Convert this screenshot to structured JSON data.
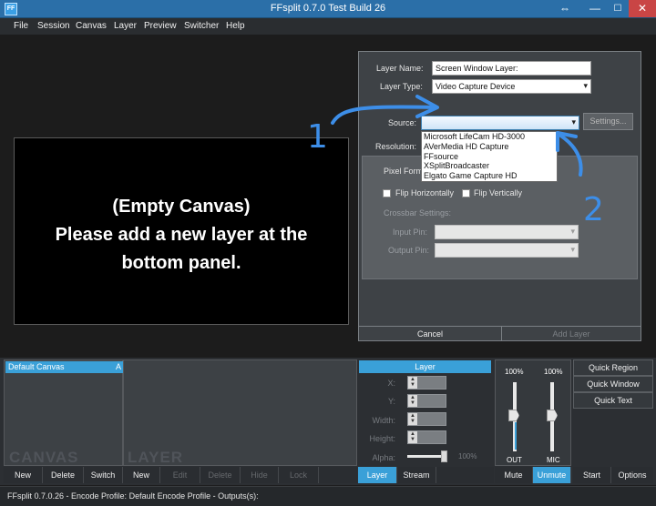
{
  "window": {
    "app_icon": "FF",
    "title": "FFsplit 0.7.0 Test Build 26",
    "resize_icon": "⇔",
    "minimize": "—",
    "maximize": "☐",
    "close": "✕"
  },
  "menu": [
    "File",
    "Session",
    "Canvas",
    "Layer",
    "Preview",
    "Switcher",
    "Help"
  ],
  "canvas_preview": {
    "line1": "(Empty Canvas)",
    "line2": "Please add a new layer at the",
    "line3": "bottom panel."
  },
  "layer_dialog": {
    "layer_name_label": "Layer Name:",
    "layer_name_value": "Screen Window Layer:",
    "layer_type_label": "Layer Type:",
    "layer_type_value": "Video Capture Device",
    "source_label": "Source:",
    "settings_label": "Settings...",
    "resolution_label": "Resolution:",
    "pixel_format_label": "Pixel Forma",
    "source_options": [
      "Microsoft LifeCam HD-3000",
      "AVerMedia HD Capture",
      "FFsource",
      "XSplitBroadcaster",
      "Elgato Game Capture HD"
    ],
    "flip_horizontally_label": "Flip Horizontally",
    "flip_vertically_label": "Flip Vertically",
    "crossbar_label": "Crossbar Settings:",
    "input_pin_label": "Input Pin:",
    "output_pin_label": "Output Pin:",
    "cancel_label": "Cancel",
    "add_layer_label": "Add Layer"
  },
  "annotations": {
    "step1": "1",
    "step2": "2",
    "color": "#3d8ee8"
  },
  "canvas_panel": {
    "item": "Default Canvas",
    "item_badge": "A",
    "watermark": "CANVAS",
    "buttons": [
      "New",
      "Delete",
      "Switch"
    ]
  },
  "layer_panel": {
    "watermark": "LAYER",
    "buttons": [
      "New",
      "Edit",
      "Delete",
      "Hide",
      "Lock"
    ]
  },
  "layer_props": {
    "title": "Layer",
    "x_label": "X:",
    "y_label": "Y:",
    "width_label": "Width:",
    "height_label": "Height:",
    "alpha_label": "Alpha:",
    "alpha_value": "100%",
    "alpha_fraction": 1.0,
    "tab_layer": "Layer",
    "tab_stream": "Stream"
  },
  "audio": {
    "out_volume": "100%",
    "mic_volume": "100%",
    "out_label": "OUT",
    "mic_label": "MIC",
    "mute_label": "Mute",
    "unmute_label": "Unmute"
  },
  "quick": {
    "region": "Quick Region",
    "window": "Quick Window",
    "text": "Quick Text",
    "start": "Start",
    "options": "Options"
  },
  "status": "FFsplit 0.7.0.26 - Encode Profile: Default Encode Profile - Outputs(s):",
  "colors": {
    "accent": "#3aa0d8",
    "titlebar": "#2b6fa8"
  }
}
